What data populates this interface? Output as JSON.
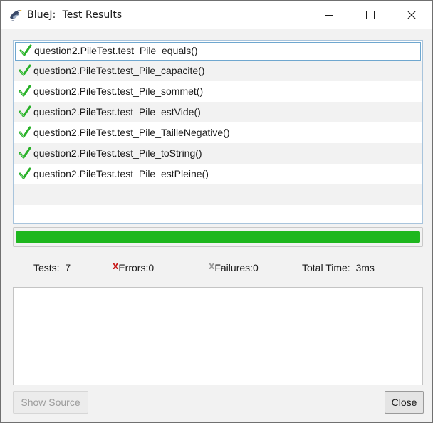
{
  "window": {
    "title": "BlueJ:  Test Results"
  },
  "icons": {
    "app": "bluej-bird-icon",
    "minimize": "minimize-icon",
    "maximize": "maximize-icon",
    "close": "close-icon",
    "test_passed": "green-check-icon"
  },
  "tests": [
    {
      "label": "question2.PileTest.test_Pile_equals()",
      "status": "passed",
      "selected": true
    },
    {
      "label": "question2.PileTest.test_Pile_capacite()",
      "status": "passed",
      "selected": false
    },
    {
      "label": "question2.PileTest.test_Pile_sommet()",
      "status": "passed",
      "selected": false
    },
    {
      "label": "question2.PileTest.test_Pile_estVide()",
      "status": "passed",
      "selected": false
    },
    {
      "label": "question2.PileTest.test_Pile_TailleNegative()",
      "status": "passed",
      "selected": false
    },
    {
      "label": "question2.PileTest.test_Pile_toString()",
      "status": "passed",
      "selected": false
    },
    {
      "label": "question2.PileTest.test_Pile_estPleine()",
      "status": "passed",
      "selected": false
    }
  ],
  "progress": {
    "fraction": 1.0,
    "color": "#1eb71e"
  },
  "summary": {
    "tests_label": "Tests:  7",
    "errors_mark": "x",
    "errors_label": "Errors:0",
    "failures_mark": "x",
    "failures_label": "Failures:0",
    "time_label": "Total Time:  3ms"
  },
  "buttons": {
    "show_source": "Show Source",
    "close": "Close"
  },
  "colors": {
    "error_mark": "#c81818",
    "failure_mark": "#9a9a9a",
    "selection_border": "#6fa7cf"
  }
}
